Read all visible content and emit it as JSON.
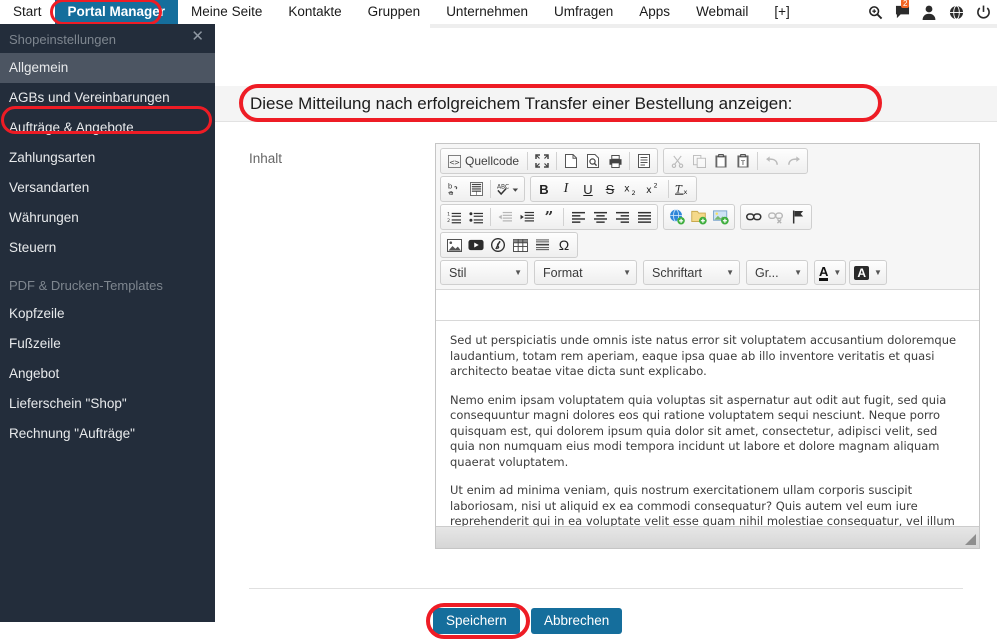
{
  "topnav": {
    "items": [
      {
        "label": "Start",
        "active": false
      },
      {
        "label": "Portal Manager",
        "active": true
      },
      {
        "label": "Meine Seite",
        "active": false
      },
      {
        "label": "Kontakte",
        "active": false
      },
      {
        "label": "Gruppen",
        "active": false
      },
      {
        "label": "Unternehmen",
        "active": false
      },
      {
        "label": "Umfragen",
        "active": false
      },
      {
        "label": "Apps",
        "active": false
      },
      {
        "label": "Webmail",
        "active": false
      },
      {
        "label": "[+]",
        "active": false
      }
    ],
    "icons": [
      "search-icon",
      "messages-icon",
      "user-icon",
      "globe-icon",
      "power-icon"
    ],
    "message_badge": "2",
    "active_bg": "#156e9c"
  },
  "sidebar": {
    "close_label": "✕",
    "groups": [
      {
        "title": "Shopeinstellungen",
        "items": [
          {
            "label": "Allgemein",
            "selected": true
          },
          {
            "label": "AGBs und Vereinbarungen",
            "selected": false
          },
          {
            "label": "Aufträge & Angebote",
            "selected": false
          },
          {
            "label": "Zahlungsarten",
            "selected": false
          },
          {
            "label": "Versandarten",
            "selected": false
          },
          {
            "label": "Währungen",
            "selected": false
          },
          {
            "label": "Steuern",
            "selected": false
          }
        ]
      },
      {
        "title": "PDF & Drucken-Templates",
        "items": [
          {
            "label": "Kopfzeile",
            "selected": false
          },
          {
            "label": "Fußzeile",
            "selected": false
          },
          {
            "label": "Angebot",
            "selected": false
          },
          {
            "label": "Lieferschein \"Shop\"",
            "selected": false
          },
          {
            "label": "Rechnung \"Aufträge\"",
            "selected": false
          }
        ]
      }
    ],
    "bg": "#232d3b",
    "selected_bg": "#4c5562"
  },
  "main": {
    "heading": "Diese Mitteilung nach erfolgreichem Transfer einer Bestellung anzeigen:",
    "field_label": "Inhalt"
  },
  "editor": {
    "source_button_label": "Quellcode",
    "dropdowns": {
      "style": "Stil",
      "format": "Format",
      "font": "Schriftart",
      "size": "Gr..."
    },
    "content_paragraphs": [
      "Sed ut perspiciatis unde omnis iste natus error sit voluptatem accusantium doloremque laudantium, totam rem aperiam, eaque ipsa quae ab illo inventore veritatis et quasi architecto beatae vitae dicta sunt explicabo.",
      "Nemo enim ipsam voluptatem quia voluptas sit aspernatur aut odit aut fugit, sed quia consequuntur magni dolores eos qui ratione voluptatem sequi nesciunt. Neque porro quisquam est, qui dolorem ipsum quia dolor sit amet, consectetur, adipisci velit, sed quia non numquam eius modi tempora incidunt ut labore et dolore magnam aliquam quaerat voluptatem.",
      "Ut enim ad minima veniam, quis nostrum exercitationem ullam corporis suscipit laboriosam, nisi ut aliquid ex ea commodi consequatur? Quis autem vel eum iure reprehenderit qui in ea voluptate velit esse quam nihil molestiae consequatur, vel illum qui dolorem eum fugiat quo voluptas nulla pariatur?"
    ]
  },
  "footer": {
    "save_label": "Speichern",
    "cancel_label": "Abbrechen",
    "button_color": "#156e9c"
  },
  "annotations": {
    "color": "#ee1c25",
    "targets": [
      "Portal Manager",
      "Allgemein",
      "heading",
      "Speichern"
    ]
  }
}
